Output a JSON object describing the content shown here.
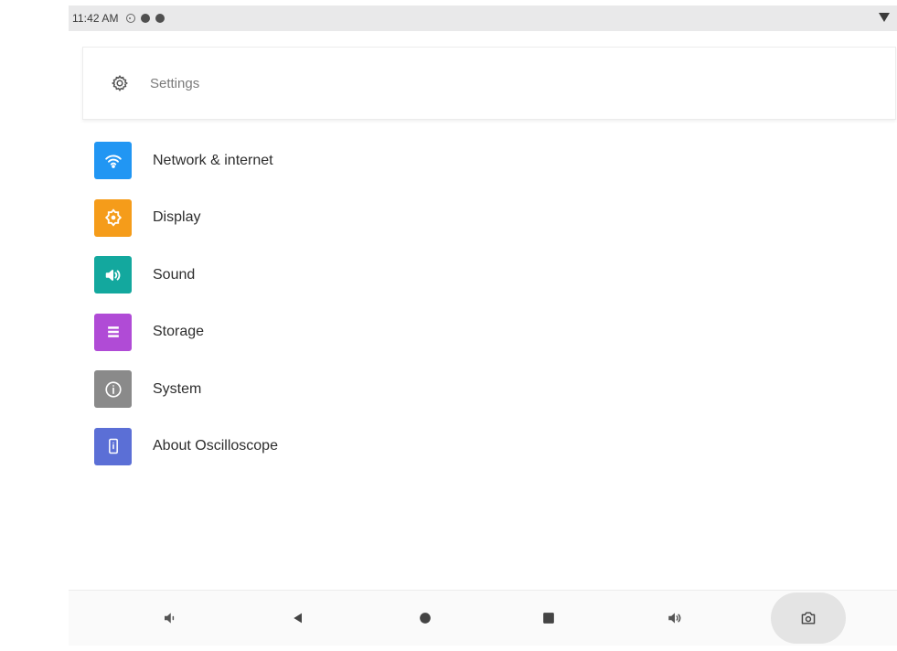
{
  "status_bar": {
    "time": "11:42 AM",
    "icons": [
      "location-icon",
      "notification-icon",
      "notification-icon"
    ],
    "right_icon": "wifi-signal-icon"
  },
  "header": {
    "icon": "gear-icon",
    "title": "Settings"
  },
  "menu": {
    "items": [
      {
        "label": "Network & internet",
        "icon": "wifi-icon",
        "color": "#2196f3"
      },
      {
        "label": "Display",
        "icon": "brightness-icon",
        "color": "#f59c1a"
      },
      {
        "label": "Sound",
        "icon": "speaker-icon",
        "color": "#13a89e"
      },
      {
        "label": "Storage",
        "icon": "list-icon",
        "color": "#b04bd6"
      },
      {
        "label": "System",
        "icon": "info-icon",
        "color": "#8a8a8a"
      },
      {
        "label": "About Oscilloscope",
        "icon": "device-icon",
        "color": "#5b6fd6"
      }
    ]
  },
  "nav_bar": {
    "buttons": [
      "volume-down-icon",
      "back-icon",
      "home-icon",
      "recents-icon",
      "volume-up-icon",
      "camera-icon"
    ]
  }
}
